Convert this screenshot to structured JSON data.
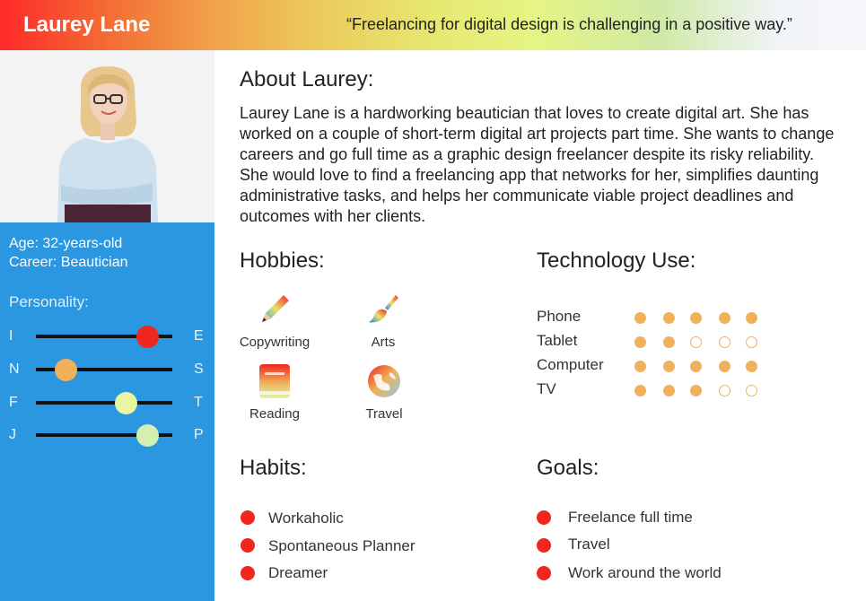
{
  "header": {
    "name": "Laurey Lane",
    "quote": "“Freelancing for digital design is challenging in a positive way.”"
  },
  "profile": {
    "age": "Age: 32-years-old",
    "career": "Career: Beautician"
  },
  "personality": {
    "title": "Personality:",
    "traits": [
      {
        "left": "I",
        "right": "E",
        "level": 0.82,
        "color": "#f1261e"
      },
      {
        "left": "N",
        "right": "S",
        "level": 0.22,
        "color": "#f0b15a"
      },
      {
        "left": "F",
        "right": "T",
        "level": 0.66,
        "color": "#e9f5a0"
      },
      {
        "left": "J",
        "right": "P",
        "level": 0.82,
        "color": "#d5efb0"
      }
    ]
  },
  "about": {
    "title": "About Laurey:",
    "text": "Laurey Lane is a hardworking beautician that loves to create digital art. She has worked on a couple of short-term digital art projects part time. She wants to change careers and go full time as a graphic design freelancer despite its risky reliability. She would love to find a freelancing app that networks for her, simplifies daunting administrative tasks, and helps her communicate viable project deadlines and outcomes with her clients."
  },
  "hobbies": {
    "title": "Hobbies:",
    "items": [
      {
        "label": "Copywriting",
        "icon": "pencil-icon"
      },
      {
        "label": "Arts",
        "icon": "paintbrush-icon"
      },
      {
        "label": "Reading",
        "icon": "book-icon"
      },
      {
        "label": "Travel",
        "icon": "globe-icon"
      }
    ]
  },
  "technology": {
    "title": "Technology Use:",
    "max": 5,
    "items": [
      {
        "label": "Phone",
        "rating": 5
      },
      {
        "label": "Tablet",
        "rating": 2
      },
      {
        "label": "Computer",
        "rating": 5
      },
      {
        "label": "TV",
        "rating": 3
      }
    ]
  },
  "habits": {
    "title": "Habits:",
    "items": [
      "Workaholic",
      "Spontaneous Planner",
      "Dreamer"
    ]
  },
  "goals": {
    "title": "Goals:",
    "items": [
      "Freelance full time",
      "Travel",
      "Work around the world"
    ]
  },
  "colors": {
    "accent_blue": "#2a97e0",
    "bullet_red": "#f1261e",
    "rating_orange": "#f0b15a"
  }
}
